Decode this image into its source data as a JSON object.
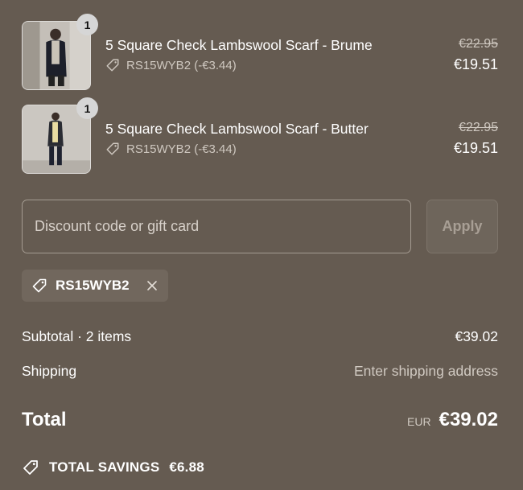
{
  "line_items": [
    {
      "quantity": "1",
      "title": "5 Square Check Lambswool Scarf - Brume",
      "discount": "RS15WYB2 (-€3.44)",
      "original_price": "€22.95",
      "final_price": "€19.51"
    },
    {
      "quantity": "1",
      "title": "5 Square Check Lambswool Scarf - Butter",
      "discount": "RS15WYB2 (-€3.44)",
      "original_price": "€22.95",
      "final_price": "€19.51"
    }
  ],
  "discount_form": {
    "placeholder": "Discount code or gift card",
    "apply_label": "Apply"
  },
  "applied_code": "RS15WYB2",
  "totals": {
    "subtotal_label": "Subtotal · 2 items",
    "subtotal_value": "€39.02",
    "shipping_label": "Shipping",
    "shipping_value": "Enter shipping address",
    "total_label": "Total",
    "currency": "EUR",
    "total_value": "€39.02"
  },
  "savings": {
    "label": "TOTAL SAVINGS",
    "value": "€6.88"
  },
  "colors": {
    "background": "#655b51",
    "text": "#ffffff",
    "muted_text": "#cfc8c0"
  },
  "icons": [
    "discount-tag-icon",
    "close-icon",
    "product-thumbnail"
  ]
}
